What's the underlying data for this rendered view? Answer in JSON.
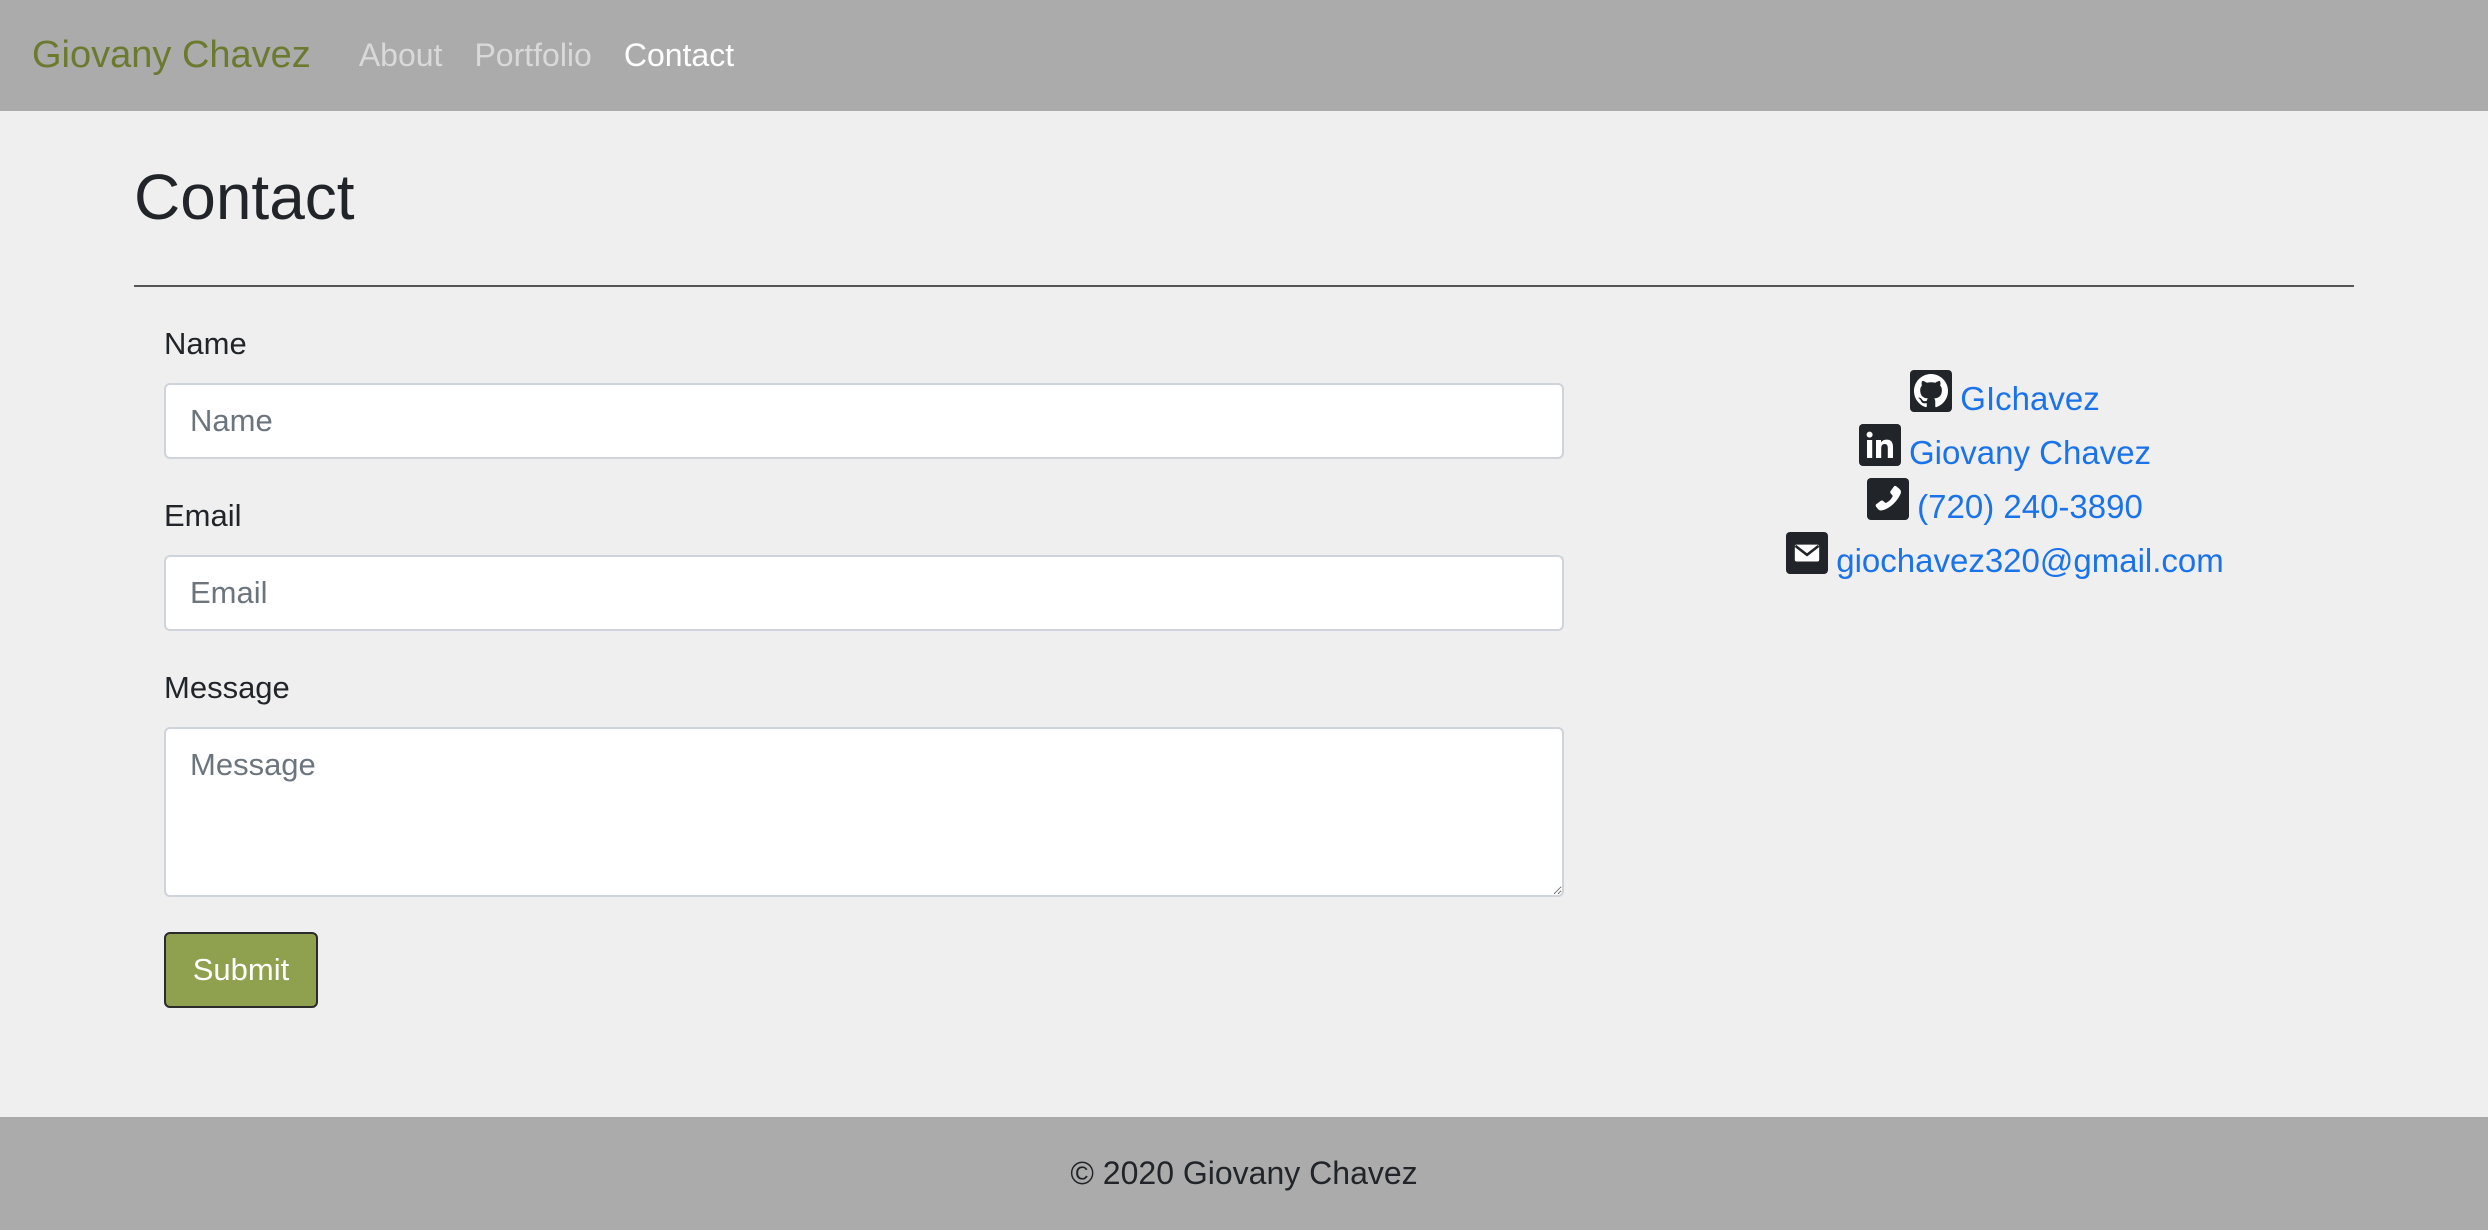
{
  "navbar": {
    "brand": "Giovany Chavez",
    "links": [
      {
        "label": "About"
      },
      {
        "label": "Portfolio"
      },
      {
        "label": "Contact"
      }
    ],
    "active": "Contact"
  },
  "page": {
    "title": "Contact"
  },
  "form": {
    "name_label": "Name",
    "name_placeholder": "Name",
    "name_value": "",
    "email_label": "Email",
    "email_placeholder": "Email",
    "email_value": "",
    "message_label": "Message",
    "message_placeholder": "Message",
    "message_value": "",
    "submit_label": "Submit"
  },
  "contacts": [
    {
      "icon": "github-icon",
      "label": "GIchavez"
    },
    {
      "icon": "linkedin-icon",
      "label": "Giovany Chavez"
    },
    {
      "icon": "phone-icon",
      "label": "(720) 240-3890"
    },
    {
      "icon": "envelope-icon",
      "label": "giochavez320@gmail.com"
    }
  ],
  "footer": {
    "text": "© 2020 Giovany Chavez"
  },
  "colors": {
    "navbar_bg": "#ababab",
    "page_bg": "#efefef",
    "brand": "#6b7a2e",
    "link": "#1a73e8",
    "submit_bg": "#8fa04f"
  }
}
